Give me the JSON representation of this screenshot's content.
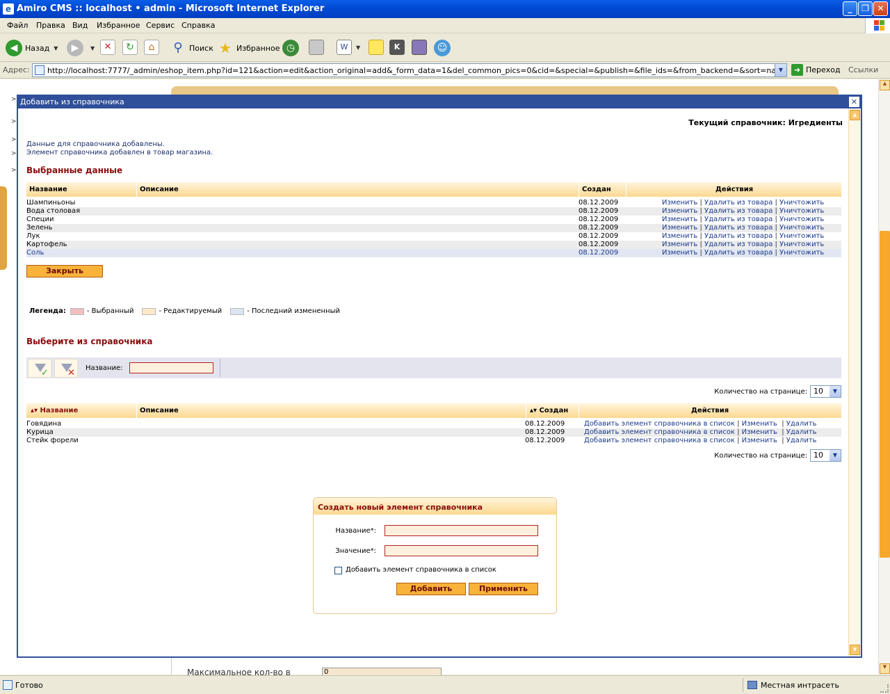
{
  "window": {
    "title": "Amiro CMS :: localhost • admin - Microsoft Internet Explorer",
    "minimize": "_",
    "maximize": "❐",
    "close": "✕"
  },
  "menu": [
    "Файл",
    "Правка",
    "Вид",
    "Избранное",
    "Сервис",
    "Справка"
  ],
  "toolbar": {
    "back": "Назад",
    "search": "Поиск",
    "favorites": "Избранное"
  },
  "address": {
    "label": "Адрес:",
    "url": "http://localhost:7777/_admin/eshop_item.php?id=121&action=edit&action_original=add&_form_data=1&del_common_pics=0&cid=&special=&publish=&file_ids=&from_backend=&sort=name&sdim=asc&offset=0&limit",
    "go": "Переход",
    "links": "Ссылки"
  },
  "background_page": {
    "label": "Максимальное кол-во в",
    "value": "0"
  },
  "dialog": {
    "title": "Добавить из справочника",
    "close": "✕",
    "current_dir": "Текущий справочник: Игредиенты",
    "msg1": "Данные для справочника добавлены.",
    "msg2": "Элемент справочника добавлен в товар магазина.",
    "selected_title": "Выбранные данные",
    "selected_table": {
      "headers": [
        "Название",
        "Описание",
        "Создан",
        "Действия"
      ],
      "actions": [
        "Изменить",
        "Удалить из товара",
        "Уничтожить"
      ],
      "rows": [
        {
          "name": "Шампиньоны",
          "date": "08.12.2009"
        },
        {
          "name": "Вода столовая",
          "date": "08.12.2009"
        },
        {
          "name": "Специи",
          "date": "08.12.2009"
        },
        {
          "name": "Зелень",
          "date": "08.12.2009"
        },
        {
          "name": "Лук",
          "date": "08.12.2009"
        },
        {
          "name": "Картофель",
          "date": "08.12.2009"
        },
        {
          "name": "Соль",
          "date": "08.12.2009"
        }
      ]
    },
    "close_button": "Закрыть",
    "legend": {
      "label": "Легенда:",
      "items": [
        {
          "text": "- Выбранный",
          "color": "#f0c0c0"
        },
        {
          "text": "- Редактируемый",
          "color": "#fde8c8"
        },
        {
          "text": "- Последний измененный",
          "color": "#dde4f2"
        }
      ]
    },
    "choose_title": "Выберите из справочника",
    "filter": {
      "label": "Название:",
      "value": ""
    },
    "per_page_label": "Количество на странице:",
    "per_page_value": "10",
    "choose_table": {
      "headers": [
        "Название",
        "Описание",
        "Создан",
        "Действия"
      ],
      "actions": [
        "Добавить элемент справочника в список",
        "Изменить",
        "Удалить"
      ],
      "rows": [
        {
          "name": "Говядина",
          "date": "08.12.2009"
        },
        {
          "name": "Курица",
          "date": "08.12.2009"
        },
        {
          "name": "Стейк форели",
          "date": "08.12.2009"
        }
      ]
    },
    "create": {
      "title": "Создать новый элемент справочника",
      "name_label": "Название*:",
      "value_label": "Значение*:",
      "checkbox_label": "Добавить элемент справочника в список",
      "add_button": "Добавить",
      "apply_button": "Применить"
    }
  },
  "status": {
    "text": "Готово",
    "zone": "Местная интрасеть"
  }
}
